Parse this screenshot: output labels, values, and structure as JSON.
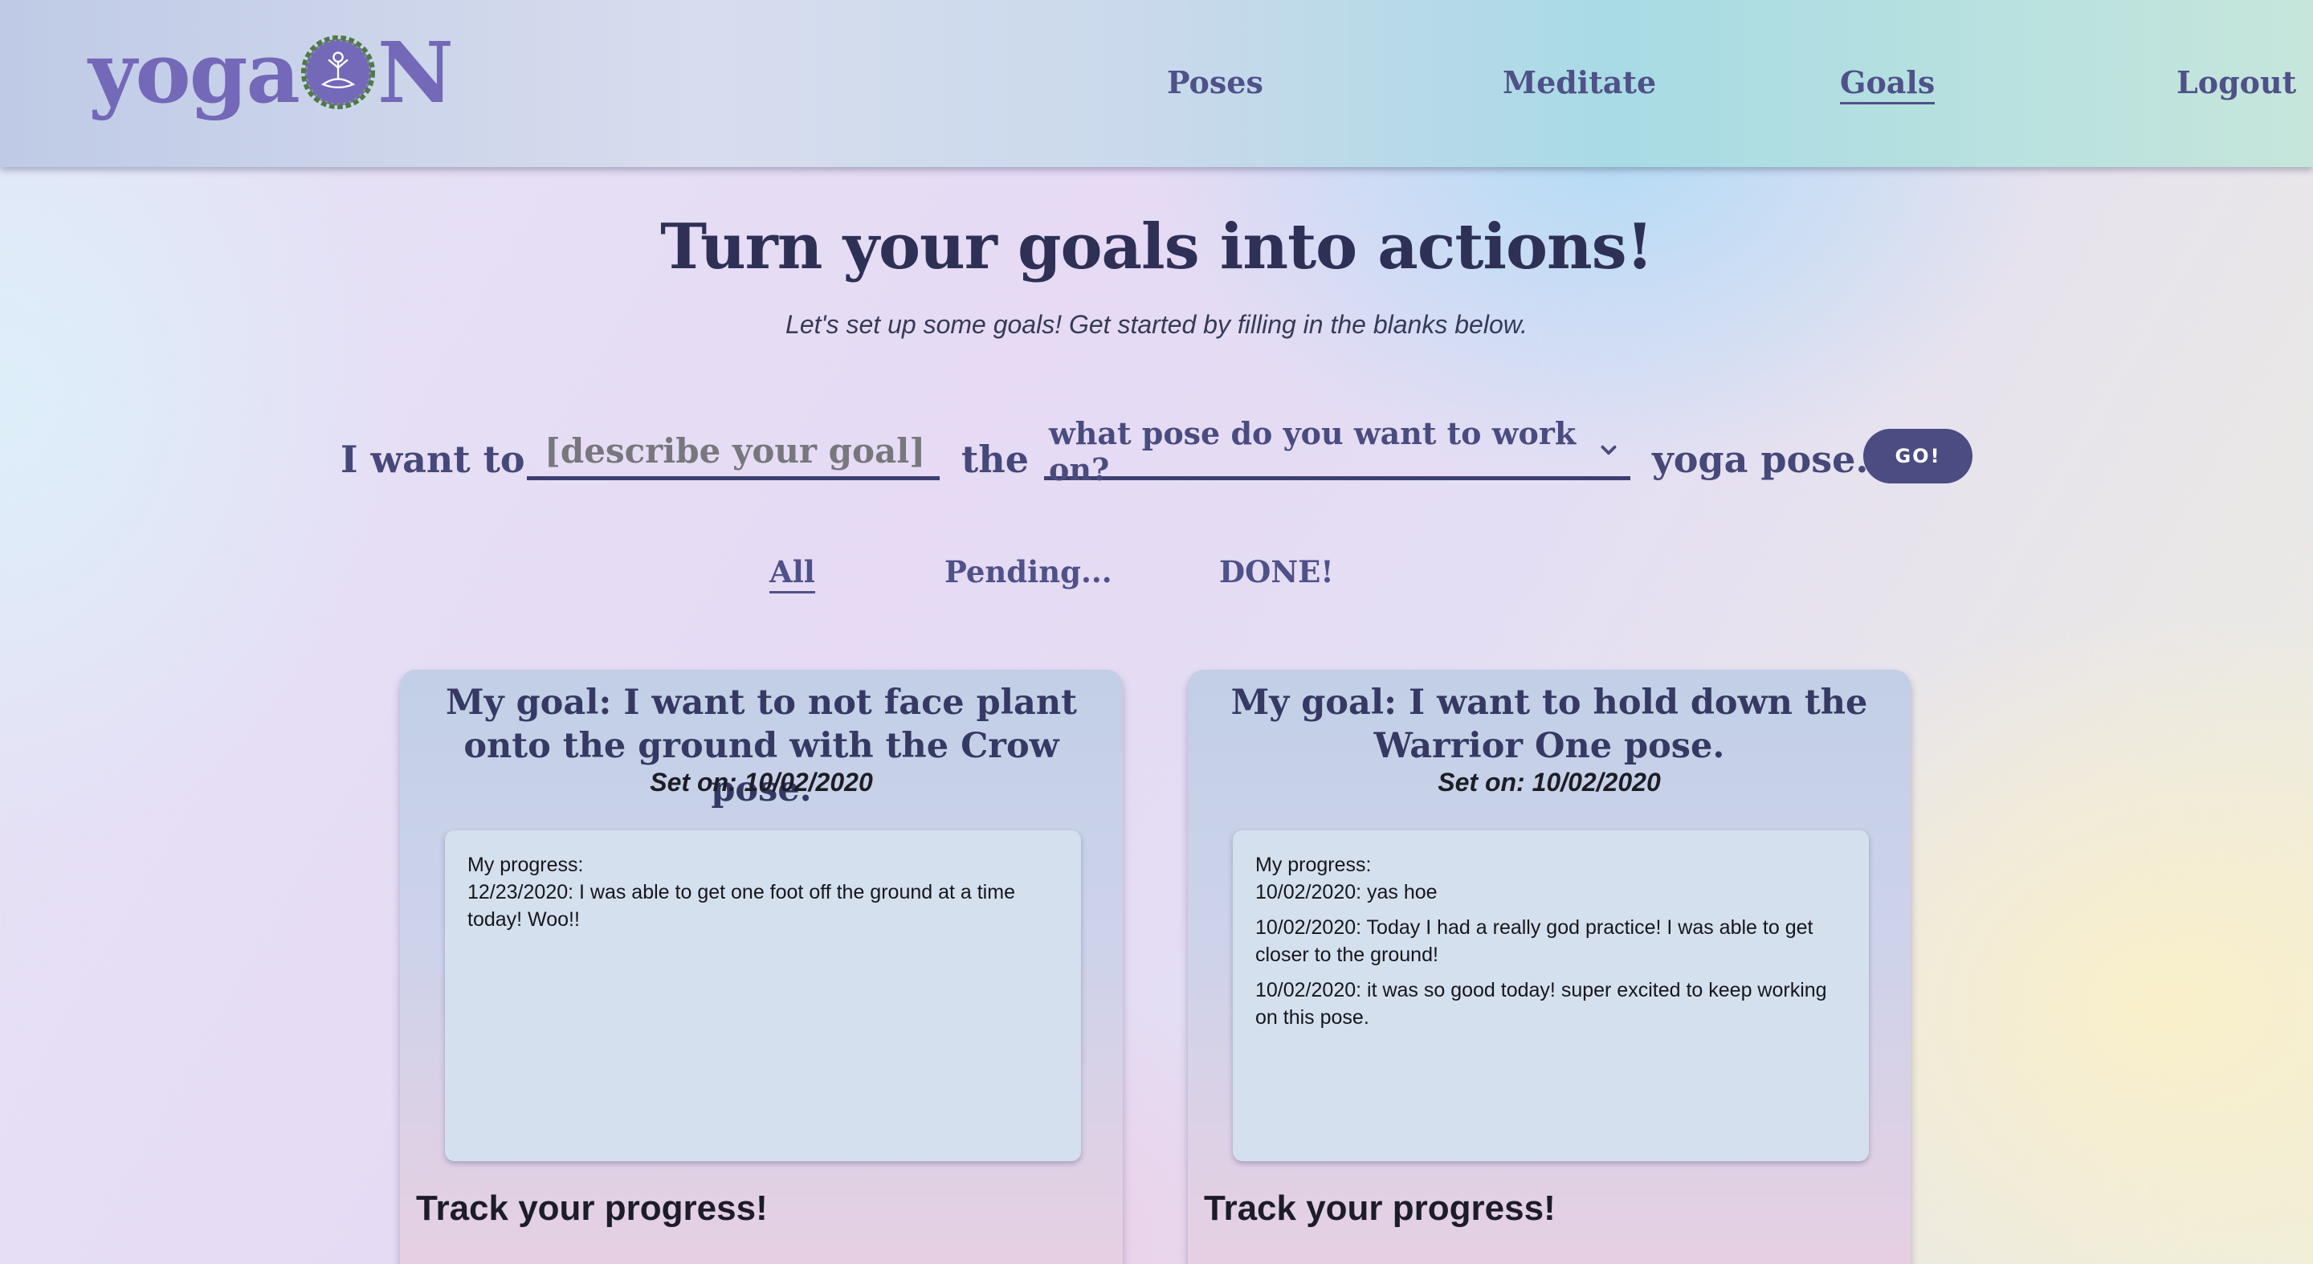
{
  "header": {
    "logo_text_left": "yoga",
    "logo_text_right": "N",
    "nav": [
      {
        "label": "Poses",
        "active": false
      },
      {
        "label": "Meditate",
        "active": false
      },
      {
        "label": "Goals",
        "active": true
      },
      {
        "label": "Logout",
        "active": false
      }
    ]
  },
  "hero": {
    "title": "Turn your goals into actions!",
    "subtitle": "Let's set up some goals! Get started by filling in the blanks below."
  },
  "goal_form": {
    "prefix": "I want to",
    "goal_placeholder": "[describe your goal]",
    "connector": "the",
    "pose_select_value": "what pose do you want to work on?",
    "suffix": "yoga pose.",
    "submit_label": "GO!"
  },
  "filters": [
    {
      "label": "All",
      "active": true
    },
    {
      "label": "Pending...",
      "active": false
    },
    {
      "label": "DONE!",
      "active": false
    }
  ],
  "goals": [
    {
      "title": "My goal: I want to not face plant onto the ground with the Crow pose.",
      "set_on": "Set on: 10/02/2020",
      "progress_label": "My progress:",
      "entries": [
        "12/23/2020: I was able to get one foot off the ground at a time today! Woo!!"
      ],
      "track_label": "Track your progress!"
    },
    {
      "title": "My goal: I want to hold down the Warrior One pose.",
      "set_on": "Set on: 10/02/2020",
      "progress_label": "My progress:",
      "entries": [
        "10/02/2020: yas hoe",
        "10/02/2020: Today I had a really god practice! I was able to get closer to the ground!",
        "10/02/2020: it was so good today! super excited to keep working on this pose."
      ],
      "track_label": "Track your progress!"
    }
  ],
  "colors": {
    "brand": "#7468b8",
    "nav_text": "#4f5189",
    "title_text": "#2e3056",
    "button": "#4b4c82"
  },
  "icons": {
    "logo_mark": "meditating-figure-wreath-icon",
    "select_arrow": "chevron-down-icon"
  }
}
